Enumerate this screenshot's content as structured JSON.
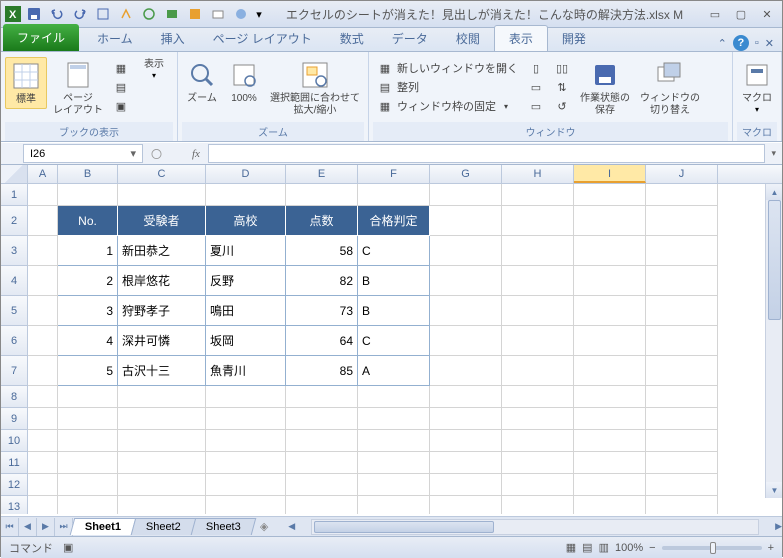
{
  "title": "エクセルのシートが消えた！見出しが消えた！こんな時の解決方法.xlsx M",
  "qat": [
    "save",
    "undo",
    "redo",
    "print",
    "open",
    "new",
    "format",
    "sort",
    "mail",
    "preview"
  ],
  "tabs": {
    "file": "ファイル",
    "home": "ホーム",
    "insert": "挿入",
    "pagelayout": "ページ レイアウト",
    "formulas": "数式",
    "data": "データ",
    "review": "校閲",
    "view": "表示",
    "developer": "開発"
  },
  "ribbon": {
    "g1": {
      "label": "ブックの表示",
      "normal": "標準",
      "pagelayout": "ページ\nレイアウト",
      "show": "表示"
    },
    "g2": {
      "label": "ズーム",
      "zoom": "ズーム",
      "z100": "100%",
      "zoomsel": "選択範囲に合わせて\n拡大/縮小"
    },
    "g3": {
      "label": "ウィンドウ",
      "newwin": "新しいウィンドウを開く",
      "arrange": "整列",
      "freeze": "ウィンドウ枠の固定",
      "save": "作業状態の\n保存",
      "switch": "ウィンドウの\n切り替え"
    },
    "g4": {
      "label": "マクロ",
      "macro": "マクロ"
    }
  },
  "namebox": "I26",
  "cols": {
    "A": 30,
    "B": 60,
    "C": 88,
    "D": 80,
    "E": 72,
    "F": 72,
    "G": 72,
    "H": 72,
    "I": 72,
    "J": 72
  },
  "headers": [
    "No.",
    "受験者",
    "高校",
    "点数",
    "合格判定"
  ],
  "rows": [
    {
      "no": 1,
      "name": "新田恭之",
      "school": "夏川",
      "score": 58,
      "grade": "C"
    },
    {
      "no": 2,
      "name": "根岸悠花",
      "school": "反野",
      "score": 82,
      "grade": "B"
    },
    {
      "no": 3,
      "name": "狩野孝子",
      "school": "鳴田",
      "score": 73,
      "grade": "B"
    },
    {
      "no": 4,
      "name": "深井可憐",
      "school": "坂岡",
      "score": 64,
      "grade": "C"
    },
    {
      "no": 5,
      "name": "古沢十三",
      "school": "魚青川",
      "score": 85,
      "grade": "A"
    }
  ],
  "sheets": [
    "Sheet1",
    "Sheet2",
    "Sheet3"
  ],
  "status": {
    "mode": "コマンド",
    "zoom": "100%"
  }
}
